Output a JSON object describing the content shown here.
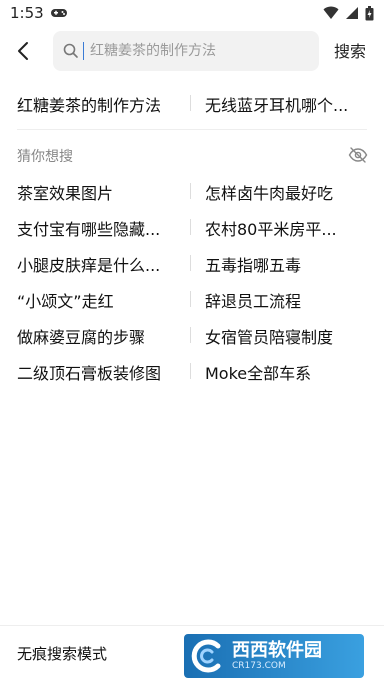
{
  "status_bar": {
    "time": "1:53",
    "icons": [
      "gamepad-icon",
      "wifi-icon",
      "signal-icon",
      "battery-icon"
    ]
  },
  "search": {
    "placeholder": "红糖姜茶的制作方法",
    "button_label": "搜索"
  },
  "history": {
    "items": [
      "红糖姜茶的制作方法",
      "无线蓝牙耳机哪个..."
    ]
  },
  "suggestions": {
    "title": "猜你想搜",
    "items": [
      [
        "茶室效果图片",
        "怎样卤牛肉最好吃"
      ],
      [
        "支付宝有哪些隐藏...",
        "农村80平米房平..."
      ],
      [
        "小腿皮肤痒是什么...",
        "五毒指哪五毒"
      ],
      [
        "“小颂文”走红",
        "辞退员工流程"
      ],
      [
        "做麻婆豆腐的步骤",
        "女宿管员陪寝制度"
      ],
      [
        "二级顶石膏板装修图",
        "Moke全部车系"
      ]
    ]
  },
  "bottom": {
    "incognito_label": "无痕搜索模式"
  },
  "watermark": {
    "brand": "西西软件园",
    "domain": "CR173.COM"
  },
  "colors": {
    "search_bg": "#f2f2f2",
    "muted_text": "#888888",
    "cursor": "#3a7bd5"
  }
}
